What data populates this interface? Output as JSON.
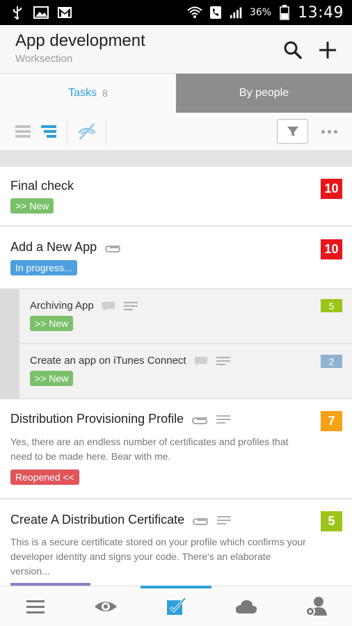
{
  "status_bar": {
    "battery_pct": "36%",
    "time": "13:49"
  },
  "app_bar": {
    "title": "App development",
    "subtitle": "Worksection"
  },
  "tabs": {
    "tasks_label": "Tasks",
    "tasks_count": "8",
    "people_label": "By people"
  },
  "colors": {
    "accent": "#2f9fd8",
    "priority_red": "#e8161b",
    "priority_lime": "#9cc51a",
    "priority_blue": "#8eb3d2",
    "priority_orange": "#f6a213"
  },
  "tasks": [
    {
      "title": "Final check",
      "status": ">> New",
      "priority": "10"
    },
    {
      "title": "Add a New App",
      "status": "In progress...",
      "priority": "10",
      "subtasks": [
        {
          "title": "Archiving App",
          "status": ">> New",
          "priority": "5"
        },
        {
          "title": "Create an app on iTunes Connect",
          "status": ">> New",
          "priority": "2"
        }
      ]
    },
    {
      "title": "Distribution Provisioning Profile",
      "description": "Yes, there are an endless number of certificates and profiles that need to be made here. Bear with me.",
      "status": "Reopened <<",
      "priority": "7"
    },
    {
      "title": "Create A Distribution Certificate",
      "description": "This is a secure certificate stored on your profile which confirms your developer identity and signs your code. There's an elaborate version...",
      "priority": "5"
    }
  ],
  "icons": {
    "status_left": [
      "usb-icon",
      "image-icon",
      "gmail-icon"
    ],
    "status_right": [
      "wifi-icon",
      "phone-icon",
      "signal-icon",
      "battery-icon"
    ],
    "bottom_nav": [
      "menu-icon",
      "eye-icon",
      "tasks-check-icon",
      "cloud-icon",
      "people-settings-icon"
    ]
  }
}
